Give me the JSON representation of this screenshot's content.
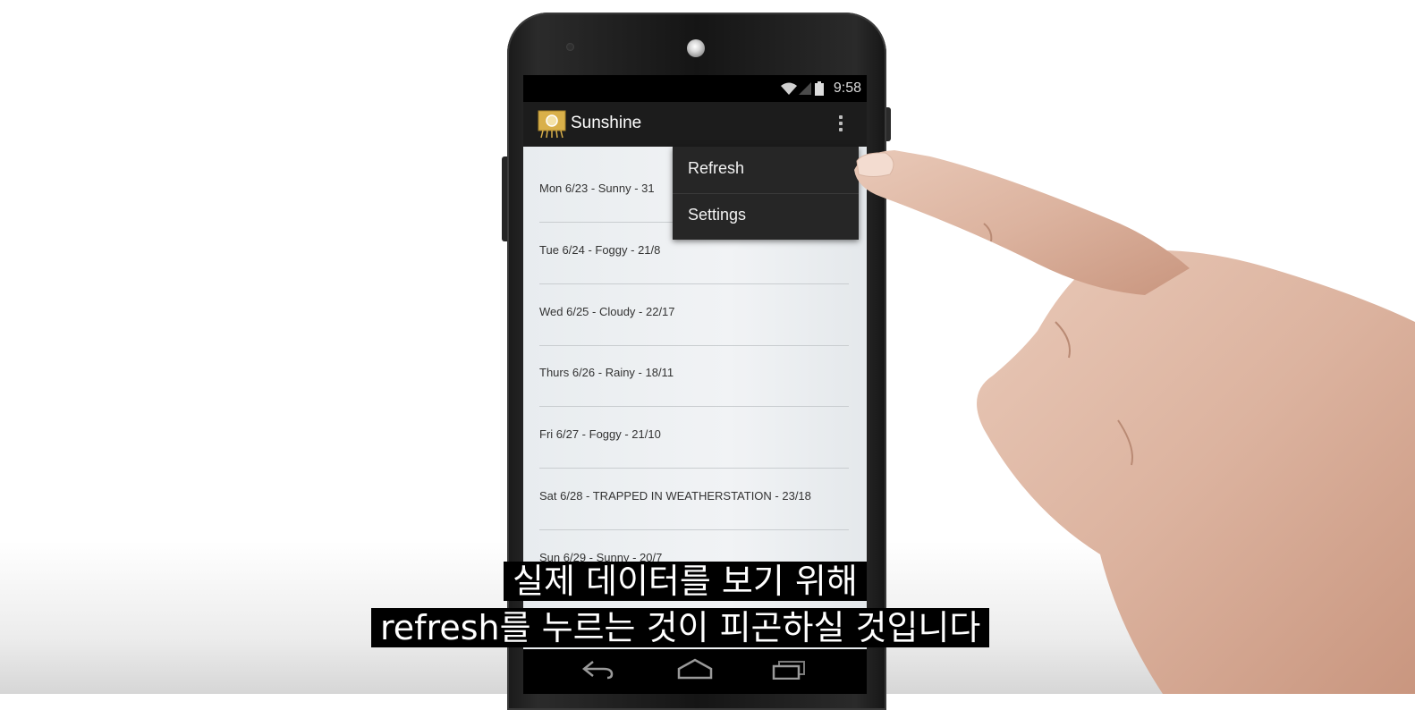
{
  "status_bar": {
    "time": "9:58",
    "icons": [
      "wifi-icon",
      "signal-icon",
      "battery-icon"
    ]
  },
  "action_bar": {
    "app_title": "Sunshine",
    "app_icon": "sun-icon",
    "overflow_icon": "overflow-menu-icon"
  },
  "forecast": {
    "items": [
      "Mon 6/23  - Sunny - 31",
      "Tue 6/24 - Foggy - 21/8",
      "Wed 6/25 - Cloudy - 22/17",
      "Thurs 6/26 - Rainy - 18/11",
      "Fri 6/27 - Foggy - 21/10",
      "Sat 6/28 - TRAPPED IN WEATHERSTATION - 23/18",
      "Sun 6/29 - Sunny - 20/7"
    ]
  },
  "overflow_menu": {
    "items": [
      "Refresh",
      "Settings"
    ]
  },
  "nav_bar": {
    "icons": [
      "back-icon",
      "home-icon",
      "recents-icon"
    ]
  },
  "captions": {
    "line1": "실제 데이터를 보기 위해",
    "line2": "refresh를 누르는 것이 피곤하실 것입니다"
  },
  "colors": {
    "screen_bg": "#eef1f3",
    "action_bar": "#1c1c1c",
    "menu_bg": "#262626",
    "caption_bg": "#000000",
    "app_icon": "#d9b04a"
  }
}
